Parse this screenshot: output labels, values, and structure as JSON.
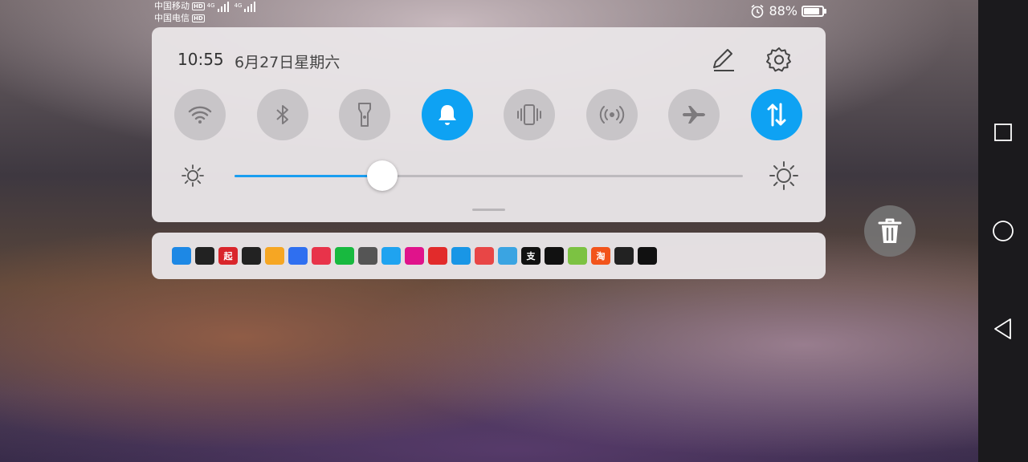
{
  "status_bar": {
    "carrier1": "中国移动",
    "carrier2": "中国电信",
    "hd_label": "HD",
    "network_label": "4G",
    "battery_percent": "88%",
    "battery_level": 0.88,
    "alarm_icon": "alarm-clock-icon"
  },
  "panel": {
    "time": "10:55",
    "date": "6月27日星期六",
    "edit_icon": "pencil-icon",
    "settings_icon": "gear-icon"
  },
  "toggles": [
    {
      "id": "wifi",
      "icon": "wifi-icon",
      "on": false
    },
    {
      "id": "bluetooth",
      "icon": "bluetooth-icon",
      "on": false
    },
    {
      "id": "flashlight",
      "icon": "flashlight-icon",
      "on": false
    },
    {
      "id": "sound",
      "icon": "bell-icon",
      "on": true
    },
    {
      "id": "vibrate",
      "icon": "vibrate-icon",
      "on": false
    },
    {
      "id": "hotspot",
      "icon": "hotspot-icon",
      "on": false
    },
    {
      "id": "airplane",
      "icon": "airplane-icon",
      "on": false
    },
    {
      "id": "mobile-data",
      "icon": "data-arrows-icon",
      "on": true
    }
  ],
  "brightness": {
    "level": 0.29
  },
  "notification_apps": [
    {
      "id": "browser",
      "color": "#1d88e5",
      "glyph": ""
    },
    {
      "id": "cloud",
      "color": "#222222",
      "glyph": ""
    },
    {
      "id": "qidian",
      "color": "#d9252b",
      "glyph": "起"
    },
    {
      "id": "wechat",
      "color": "#222222",
      "glyph": ""
    },
    {
      "id": "weibo",
      "color": "#f6a623",
      "glyph": ""
    },
    {
      "id": "baidu",
      "color": "#2f6ff0",
      "glyph": ""
    },
    {
      "id": "video",
      "color": "#e8334a",
      "glyph": ""
    },
    {
      "id": "iqiyi",
      "color": "#18b93f",
      "glyph": ""
    },
    {
      "id": "globe",
      "color": "#555555",
      "glyph": ""
    },
    {
      "id": "youku",
      "color": "#1fa3f0",
      "glyph": ""
    },
    {
      "id": "magenta-app",
      "color": "#e0138b",
      "glyph": ""
    },
    {
      "id": "netease-music",
      "color": "#e22b2b",
      "glyph": ""
    },
    {
      "id": "blue-circle",
      "color": "#1996e6",
      "glyph": ""
    },
    {
      "id": "red-book",
      "color": "#e84646",
      "glyph": ""
    },
    {
      "id": "telegram",
      "color": "#3aa4e2",
      "glyph": ""
    },
    {
      "id": "alipay",
      "color": "#111111",
      "glyph": "支"
    },
    {
      "id": "huawei-appgallery",
      "color": "#111111",
      "glyph": ""
    },
    {
      "id": "green-app",
      "color": "#7cc242",
      "glyph": ""
    },
    {
      "id": "taobao",
      "color": "#f2541b",
      "glyph": "淘"
    },
    {
      "id": "hexagon-app",
      "color": "#222222",
      "glyph": ""
    },
    {
      "id": "chat-bubble",
      "color": "#111111",
      "glyph": ""
    }
  ],
  "trash_icon": "trash-icon",
  "nav": {
    "recents_icon": "square-icon",
    "home_icon": "circle-icon",
    "back_icon": "triangle-back-icon"
  }
}
